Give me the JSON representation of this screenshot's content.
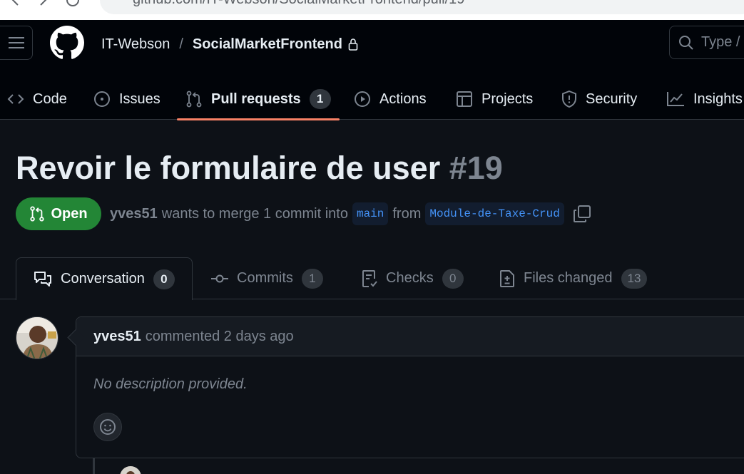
{
  "browser": {
    "url": "github.com/IT-Webson/SocialMarketFrontend/pull/19"
  },
  "header": {
    "owner": "IT-Webson",
    "separator": "/",
    "repo": "SocialMarketFrontend",
    "search_placeholder": "Type /"
  },
  "repo_nav": {
    "tabs": [
      {
        "label": "Code",
        "icon": "code-icon"
      },
      {
        "label": "Issues",
        "icon": "issue-icon"
      },
      {
        "label": "Pull requests",
        "icon": "pull-request-icon",
        "count": "1",
        "selected": true
      },
      {
        "label": "Actions",
        "icon": "play-icon"
      },
      {
        "label": "Projects",
        "icon": "table-icon"
      },
      {
        "label": "Security",
        "icon": "shield-icon"
      },
      {
        "label": "Insights",
        "icon": "graph-icon"
      }
    ]
  },
  "pr": {
    "title": "Revoir le formulaire de user",
    "number": "#19",
    "state": "Open",
    "state_color": "#238636",
    "author": "yves51",
    "merge_text": "wants to merge 1 commit into",
    "base_branch": "main",
    "from_text": "from",
    "head_branch": "Module-de-Taxe-Crud"
  },
  "pr_tabs": [
    {
      "label": "Conversation",
      "count": "0",
      "icon": "comment-discussion-icon"
    },
    {
      "label": "Commits",
      "count": "1",
      "icon": "commit-icon"
    },
    {
      "label": "Checks",
      "count": "0",
      "icon": "checklist-icon"
    },
    {
      "label": "Files changed",
      "count": "13",
      "icon": "file-diff-icon"
    }
  ],
  "comment": {
    "author": "yves51",
    "meta": "commented 2 days ago",
    "body": "No description provided."
  },
  "colors": {
    "accent_underline": "#f78166",
    "link": "#4493f8",
    "background": "#0d1117"
  }
}
